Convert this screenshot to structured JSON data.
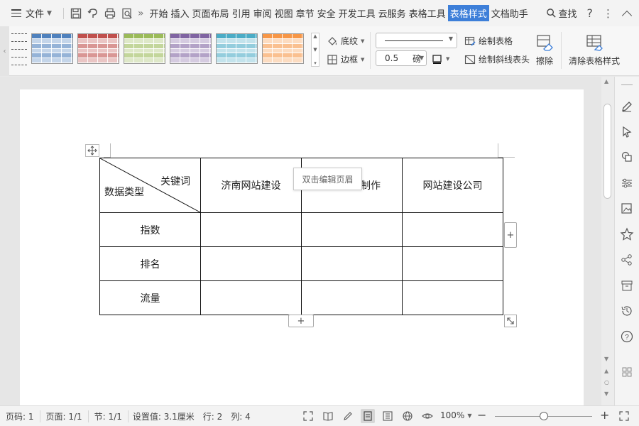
{
  "menubar": {
    "file_label": "文件",
    "more": "»",
    "tabs": [
      "开始",
      "插入",
      "页面布局",
      "引用",
      "审阅",
      "视图",
      "章节",
      "安全",
      "开发工具",
      "云服务",
      "表格工具",
      "表格样式",
      "文档助手"
    ],
    "active_tab": "表格样式",
    "find_label": "查找",
    "help": "?",
    "more_dots": "⋮",
    "collapse": "^"
  },
  "ribbon": {
    "style_colors": [
      "#4f81bd",
      "#c0504d",
      "#9bbb59",
      "#8064a2",
      "#4bacc6",
      "#f79646"
    ],
    "shading_label": "底纹",
    "border_label": "边框",
    "line_weight_value": "0.5",
    "line_weight_unit": "磅",
    "draw_table_label": "绘制表格",
    "draw_diag_label": "绘制斜线表头",
    "erase_label": "擦除",
    "clear_style_label": "清除表格样式"
  },
  "document": {
    "header_tooltip": "双击编辑页眉",
    "diag_keyword": "关键词",
    "diag_datatype": "数据类型",
    "col_headers": [
      "济南网站建设",
      "济南网站制作",
      "网站建设公司"
    ],
    "col2_visible": "制作",
    "row_labels": [
      "指数",
      "排名",
      "流量"
    ],
    "add_symbol": "+"
  },
  "status": {
    "page_no": "页码: 1",
    "page_count": "页面: 1/1",
    "section": "节: 1/1",
    "setting": "设置值: 3.1厘米",
    "row": "行: 2",
    "col": "列: 4",
    "zoom": "100%",
    "minus": "−",
    "plus": "+"
  }
}
